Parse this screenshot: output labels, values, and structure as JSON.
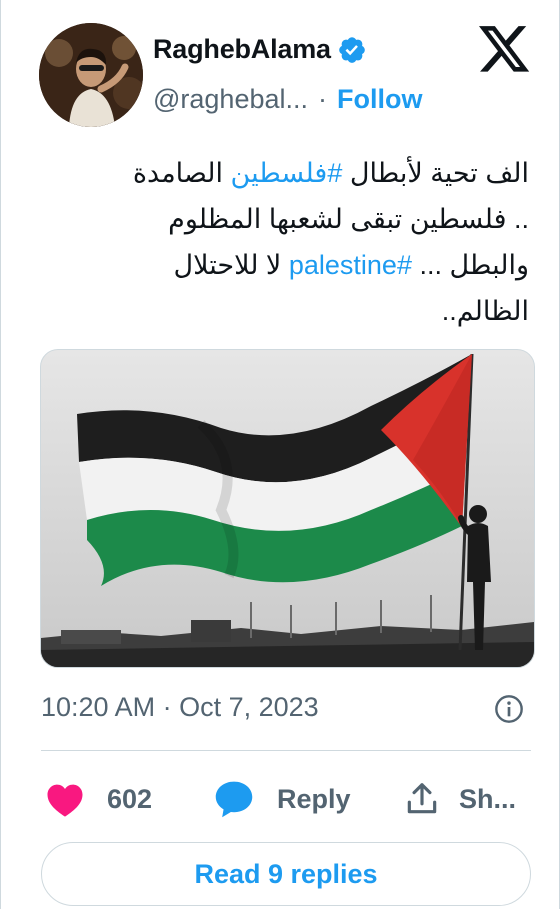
{
  "header": {
    "display_name": "RaghebAlama",
    "handle": "@raghebal...",
    "separator": "·",
    "follow_label": "Follow"
  },
  "tweet": {
    "line1_pre": "الف تحية لأبطال ",
    "line1_hashtag": "#فلسطين",
    "line1_post": " الصامدة",
    "line2": ".. فلسطين تبقى لشعبها المظلوم",
    "line3_pre": "والبطل ... ",
    "line3_hashtag": "#palestine",
    "line3_post": " لا للاحتلال",
    "line4": "الظالم.."
  },
  "meta": {
    "time": "10:20 AM",
    "separator": "·",
    "date": "Oct 7, 2023"
  },
  "actions": {
    "like_count": "602",
    "reply_label": "Reply",
    "share_label": "Sh..."
  },
  "footer": {
    "read_replies_label": "Read 9 replies"
  },
  "colors": {
    "accent": "#1d9bf0",
    "like": "#f91880",
    "text": "#0f1419",
    "muted": "#536471",
    "border": "#cfd9de"
  },
  "icons": {
    "logo": "x-logo-icon",
    "verified": "verified-badge-icon",
    "info": "info-icon",
    "like": "heart-icon",
    "reply": "speech-bubble-icon",
    "share": "share-upload-icon"
  }
}
